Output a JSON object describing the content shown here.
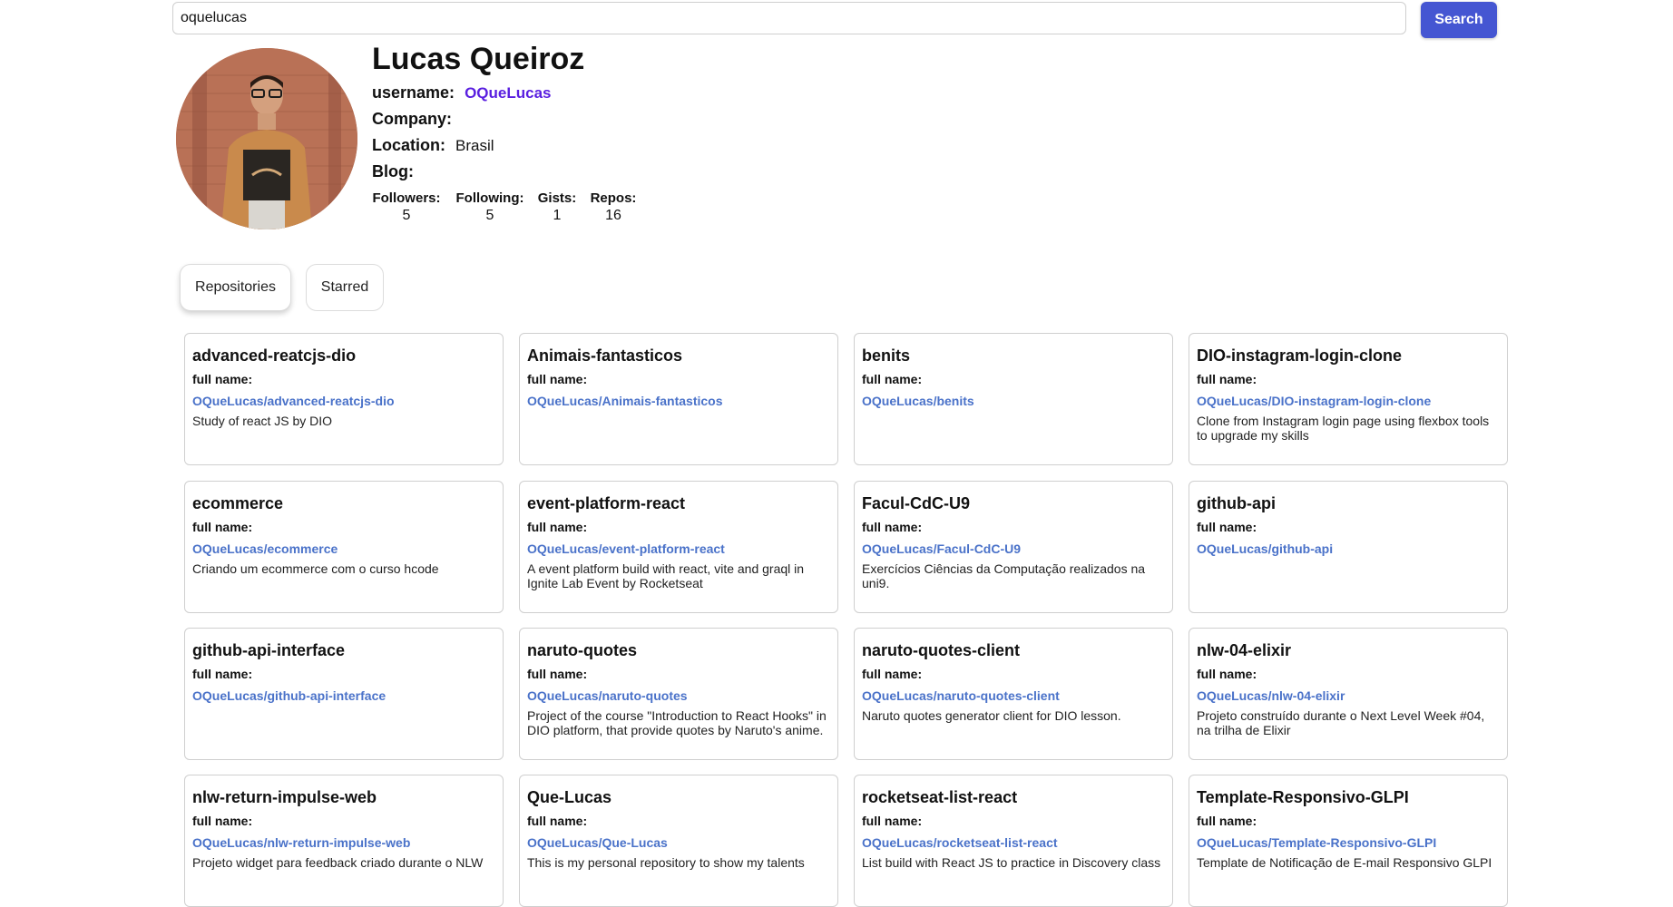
{
  "search": {
    "value": "oquelucas",
    "button_label": "Search"
  },
  "profile": {
    "name": "Lucas Queiroz",
    "username_label": "username:",
    "username": "OQueLucas",
    "company_label": "Company:",
    "company": "",
    "location_label": "Location:",
    "location": "Brasil",
    "blog_label": "Blog:",
    "blog": "",
    "stats": [
      {
        "label": "Followers:",
        "value": "5"
      },
      {
        "label": "Following:",
        "value": "5"
      },
      {
        "label": "Gists:",
        "value": "1"
      },
      {
        "label": "Repos:",
        "value": "16"
      }
    ]
  },
  "tabs": [
    {
      "label": "Repositories",
      "active": true
    },
    {
      "label": "Starred",
      "active": false
    }
  ],
  "repos": {
    "fullname_label": "full name:",
    "items": [
      {
        "name": "advanced-reatcjs-dio",
        "full_name": "OQueLucas/advanced-reatcjs-dio",
        "description": "Study of react JS by DIO"
      },
      {
        "name": "Animais-fantasticos",
        "full_name": "OQueLucas/Animais-fantasticos",
        "description": ""
      },
      {
        "name": "benits",
        "full_name": "OQueLucas/benits",
        "description": ""
      },
      {
        "name": "DIO-instagram-login-clone",
        "full_name": "OQueLucas/DIO-instagram-login-clone",
        "description": "Clone from Instagram login page using flexbox tools to upgrade my skills"
      },
      {
        "name": "ecommerce",
        "full_name": "OQueLucas/ecommerce",
        "description": "Criando um ecommerce com o curso hcode"
      },
      {
        "name": "event-platform-react",
        "full_name": "OQueLucas/event-platform-react",
        "description": "A event platform build with react, vite and graql in Ignite Lab Event by Rocketseat"
      },
      {
        "name": "Facul-CdC-U9",
        "full_name": "OQueLucas/Facul-CdC-U9",
        "description": "Exercícios Ciências da Computação realizados na uni9."
      },
      {
        "name": "github-api",
        "full_name": "OQueLucas/github-api",
        "description": ""
      },
      {
        "name": "github-api-interface",
        "full_name": "OQueLucas/github-api-interface",
        "description": ""
      },
      {
        "name": "naruto-quotes",
        "full_name": "OQueLucas/naruto-quotes",
        "description": "Project of the course \"Introduction to React Hooks\" in DIO platform, that provide quotes by Naruto's anime."
      },
      {
        "name": "naruto-quotes-client",
        "full_name": "OQueLucas/naruto-quotes-client",
        "description": "Naruto quotes generator client for DIO lesson."
      },
      {
        "name": "nlw-04-elixir",
        "full_name": "OQueLucas/nlw-04-elixir",
        "description": "Projeto construído durante o Next Level Week #04, na trilha de Elixir"
      },
      {
        "name": "nlw-return-impulse-web",
        "full_name": "OQueLucas/nlw-return-impulse-web",
        "description": "Projeto widget para feedback criado durante o NLW"
      },
      {
        "name": "Que-Lucas",
        "full_name": "OQueLucas/Que-Lucas",
        "description": "This is my personal repository to show my talents"
      },
      {
        "name": "rocketseat-list-react",
        "full_name": "OQueLucas/rocketseat-list-react",
        "description": "List build with React JS to practice in Discovery class"
      },
      {
        "name": "Template-Responsivo-GLPI",
        "full_name": "OQueLucas/Template-Responsivo-GLPI",
        "description": "Template de Notificação de E-mail Responsivo GLPI"
      }
    ]
  }
}
